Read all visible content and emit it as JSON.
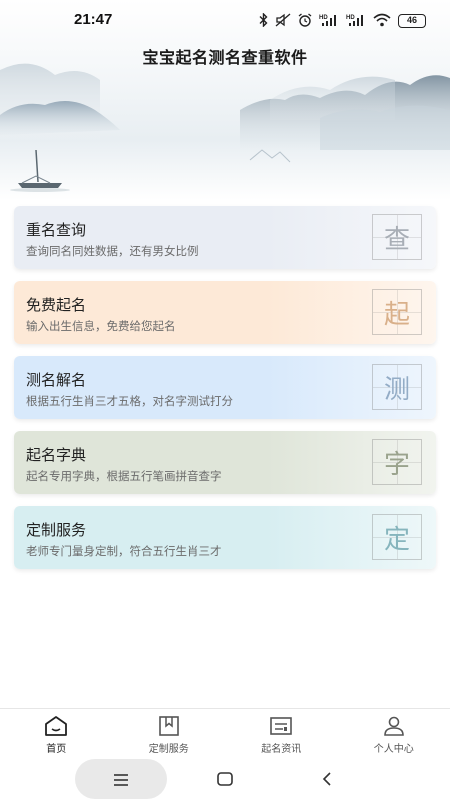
{
  "status_bar": {
    "time": "21:47",
    "battery": "46",
    "icons": [
      "bluetooth-icon",
      "mute-icon",
      "alarm-icon",
      "hd-signal-icon",
      "hd-signal-icon",
      "wifi-icon",
      "battery-icon"
    ]
  },
  "header": {
    "title": "宝宝起名测名查重软件"
  },
  "cards": [
    {
      "title": "重名查询",
      "desc": "查询同名同姓数据，还有男女比例",
      "char": "查",
      "bg": "#e9edf4",
      "char_color": "#a8aeb6"
    },
    {
      "title": "免费起名",
      "desc": "输入出生信息，免费给您起名",
      "char": "起",
      "bg": "#fde9d7",
      "char_color": "#d9b08a"
    },
    {
      "title": "测名解名",
      "desc": "根据五行生肖三才五格，对名字测试打分",
      "char": "测",
      "bg": "#d8e9fb",
      "char_color": "#93acc6"
    },
    {
      "title": "起名字典",
      "desc": "起名专用字典，根据五行笔画拼音查字",
      "char": "字",
      "bg": "#dfe5d9",
      "char_color": "#9aa38d"
    },
    {
      "title": "定制服务",
      "desc": "老师专门量身定制，符合五行生肖三才",
      "char": "定",
      "bg": "#d7eef1",
      "char_color": "#86b5bd"
    }
  ],
  "bottom_nav": [
    {
      "label": "首页",
      "icon": "home-icon",
      "active": true
    },
    {
      "label": "定制服务",
      "icon": "bookmark-icon",
      "active": false
    },
    {
      "label": "起名资讯",
      "icon": "news-icon",
      "active": false
    },
    {
      "label": "个人中心",
      "icon": "user-icon",
      "active": false
    }
  ],
  "system_nav": {
    "buttons": [
      "menu-icon",
      "home-square-icon",
      "back-icon"
    ]
  }
}
